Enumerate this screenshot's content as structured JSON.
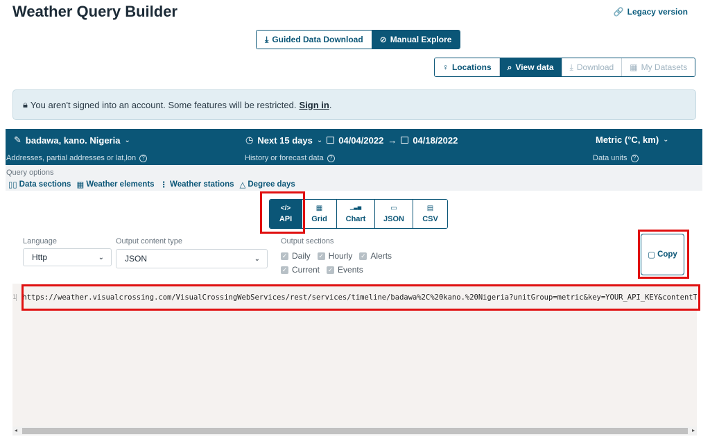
{
  "page": {
    "title": "Weather Query Builder",
    "legacy_link": "Legacy version"
  },
  "mode_switch": [
    {
      "label": "Guided Data Download",
      "icon": "download-icon",
      "active": false
    },
    {
      "label": "Manual Explore",
      "icon": "compass-icon",
      "active": true
    }
  ],
  "nav_tabs": [
    {
      "label": "Locations",
      "icon": "pin-icon",
      "state": "normal"
    },
    {
      "label": "View data",
      "icon": "search-icon",
      "state": "active"
    },
    {
      "label": "Download",
      "icon": "download-icon",
      "state": "disabled"
    },
    {
      "label": "My Datasets",
      "icon": "grid-icon",
      "state": "disabled"
    }
  ],
  "alert": {
    "text": "You aren't signed into an account. Some features will be restricted.",
    "link": "Sign in",
    "suffix": "."
  },
  "query_bar": {
    "location": "badawa, kano. Nigeria",
    "location_hint": "Addresses, partial addresses or lat,lon",
    "date_range": "Next 15 days",
    "start_date": "04/04/2022",
    "end_date": "04/18/2022",
    "date_hint": "History or forecast data",
    "units": "Metric (°C, km)",
    "units_hint": "Data units"
  },
  "query_options": {
    "label": "Query options",
    "links": [
      {
        "label": "Data sections",
        "icon": "sections-icon"
      },
      {
        "label": "Weather elements",
        "icon": "elements-icon"
      },
      {
        "label": "Weather stations",
        "icon": "stations-icon"
      },
      {
        "label": "Degree days",
        "icon": "bell-icon"
      }
    ]
  },
  "format_tabs": [
    {
      "label": "API",
      "glyph": "</>",
      "active": true
    },
    {
      "label": "Grid",
      "glyph": "▦",
      "active": false
    },
    {
      "label": "Chart",
      "glyph": "▁▃▅",
      "active": false
    },
    {
      "label": "JSON",
      "glyph": "▭",
      "active": false
    },
    {
      "label": "CSV",
      "glyph": "▤",
      "active": false
    }
  ],
  "settings": {
    "language_label": "Language",
    "language_value": "Http",
    "content_type_label": "Output content type",
    "content_type_value": "JSON",
    "sections_label": "Output sections",
    "sections": [
      {
        "label": "Daily",
        "checked": true
      },
      {
        "label": "Hourly",
        "checked": true
      },
      {
        "label": "Alerts",
        "checked": true
      },
      {
        "label": "Current",
        "checked": true
      },
      {
        "label": "Events",
        "checked": true
      }
    ]
  },
  "copy_button": {
    "label": "Copy"
  },
  "code": {
    "line_number": "1",
    "url": "https://weather.visualcrossing.com/VisualCrossingWebServices/rest/services/timeline/badawa%2C%20kano.%20Nigeria?unitGroup=metric&key=YOUR_API_KEY&contentType=json"
  },
  "colors": {
    "brand": "#0b5677",
    "highlight": "#e01010",
    "alert_bg": "#e3eef3",
    "code_bg": "#f5f2f0"
  }
}
